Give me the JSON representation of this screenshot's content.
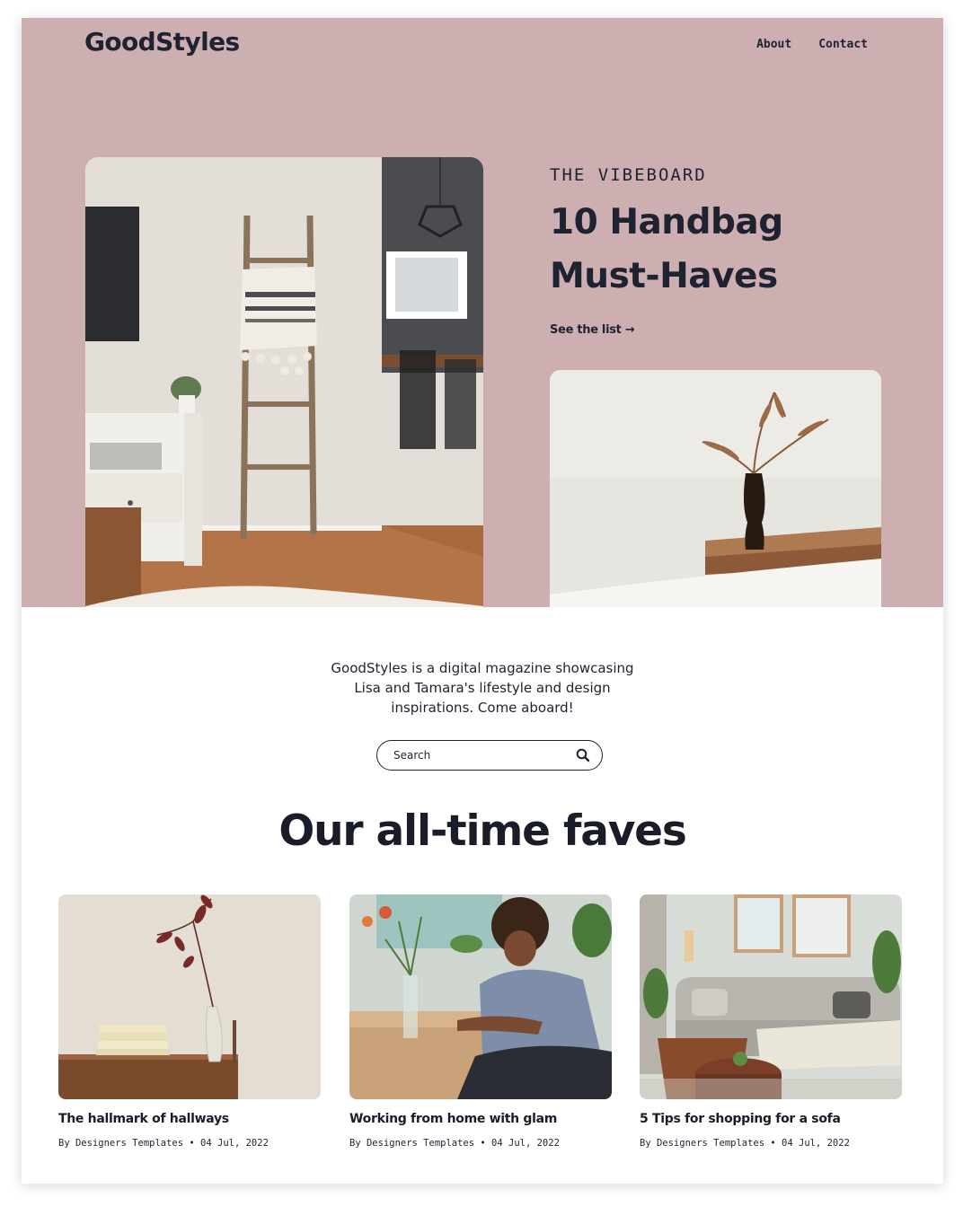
{
  "site": {
    "logo": "GoodStyles"
  },
  "nav": {
    "items": [
      {
        "label": "About"
      },
      {
        "label": "Contact"
      }
    ]
  },
  "hero": {
    "kicker": "THE VIBEBOARD",
    "headline": "10 Handbag Must-Haves",
    "link_label": "See the list →"
  },
  "intro": {
    "text": "GoodStyles is a digital magazine showcasing Lisa and Tamara's lifestyle and design inspirations. Come aboard!"
  },
  "search": {
    "placeholder": "Search",
    "icon": "search-icon"
  },
  "faves": {
    "title": "Our all-time faves",
    "cards": [
      {
        "title": "The hallmark of hallways",
        "meta": "By Designers Templates • 04 Jul, 2022"
      },
      {
        "title": "Working from home with glam",
        "meta": "By Designers Templates • 04 Jul, 2022"
      },
      {
        "title": "5 Tips for shopping for a sofa",
        "meta": "By Designers Templates • 04 Jul, 2022"
      }
    ]
  },
  "colors": {
    "hero_bg": "#cdafb1",
    "text_dark": "#1f2230",
    "page_bg": "#ffffff"
  }
}
